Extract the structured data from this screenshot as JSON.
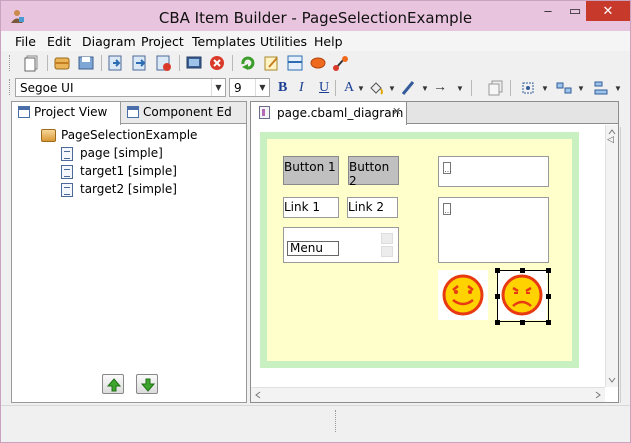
{
  "window": {
    "title": "CBA Item Builder - PageSelectionExample",
    "minimize": "–",
    "maximize": "▭",
    "close": "✕"
  },
  "menubar": {
    "items": [
      "File",
      "Edit",
      "Diagram",
      "Project",
      "Templates",
      "Utilities",
      "Help"
    ]
  },
  "toolbar": {
    "font_name": "Segoe UI",
    "font_size": "9",
    "bold": "B",
    "italic": "I",
    "underline": "U",
    "font_color": "A",
    "line_arrow": "→"
  },
  "left_panel": {
    "tabs": [
      "Project View",
      "Component Ed"
    ],
    "tree": {
      "root": "PageSelectionExample",
      "children": [
        "page [simple]",
        "target1 [simple]",
        "target2 [simple]"
      ]
    }
  },
  "editor": {
    "tab_label": "page.cbaml_diagram",
    "tab_close": "✕",
    "canvas": {
      "buttons": [
        "Button  1",
        "Button 2"
      ],
      "links": [
        "Link 1",
        "Link 2"
      ],
      "menu_value": "Menu",
      "field_glyph": "…"
    }
  },
  "colors": {
    "titlebar": "#e9c4de",
    "close_button": "#c7392b",
    "canvas_outer": "#c9f0c0",
    "canvas_inner": "#ffffcc",
    "button_fill": "#c0c0c0",
    "smiley_face": "#ffd200",
    "smiley_outline": "#e83a12"
  }
}
